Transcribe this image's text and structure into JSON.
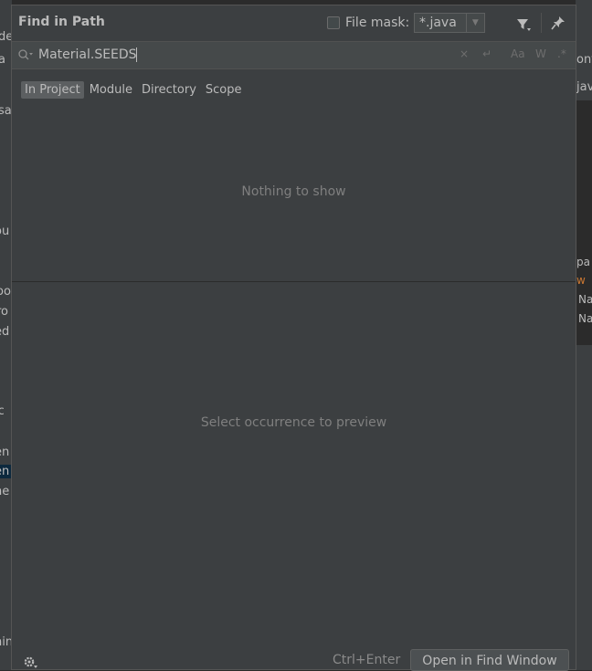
{
  "dialog": {
    "title": "Find in Path",
    "file_mask": {
      "label": "File mask:",
      "checked": false,
      "value": "*.java"
    }
  },
  "search": {
    "query": "Material.SEEDS",
    "tools": {
      "clear": "×",
      "newline": "↵",
      "match_case": "Aa",
      "words": "W",
      "regex": ".*"
    }
  },
  "scopes": [
    {
      "label": "In Project",
      "active": true
    },
    {
      "label": "Module",
      "active": false
    },
    {
      "label": "Directory",
      "active": false
    },
    {
      "label": "Scope",
      "active": false
    }
  ],
  "results": {
    "empty_text": "Nothing to show"
  },
  "preview": {
    "empty_text": "Select occurrence to preview"
  },
  "footer": {
    "shortcut": "Ctrl+Enter",
    "open_button": "Open in Find Window"
  },
  "background": {
    "left_fragments": [
      "de",
      "a",
      "sa",
      "ou",
      "oo",
      "ro",
      "ed",
      "ic",
      "en",
      "en",
      "ne",
      "hin"
    ],
    "right_fragments": [
      "onf",
      "java",
      "pa",
      "w",
      "Na",
      "Na"
    ]
  },
  "colors": {
    "dialog_bg": "#3c3f41",
    "search_bg": "#45494a",
    "active_scope_bg": "#5c5f61",
    "text": "#bbbbbb",
    "muted_text": "#7f7f7f"
  }
}
